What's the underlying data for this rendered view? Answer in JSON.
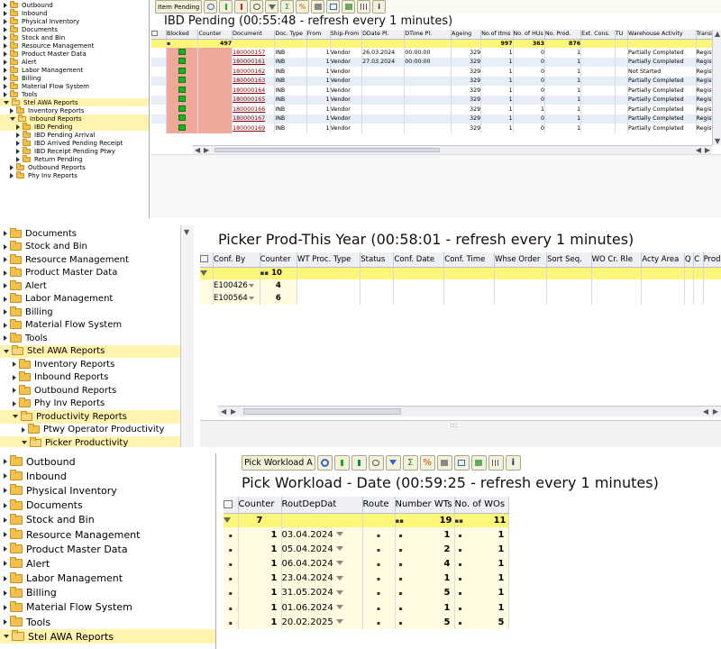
{
  "panel1": {
    "tree": [
      {
        "label": "Outbound",
        "open": false,
        "indent": 0
      },
      {
        "label": "Inbound",
        "open": false,
        "indent": 0
      },
      {
        "label": "Physical Inventory",
        "open": false,
        "indent": 0
      },
      {
        "label": "Documents",
        "open": false,
        "indent": 0
      },
      {
        "label": "Stock and Bin",
        "open": false,
        "indent": 0
      },
      {
        "label": "Resource Management",
        "open": false,
        "indent": 0
      },
      {
        "label": "Product Master Data",
        "open": false,
        "indent": 0
      },
      {
        "label": "Alert",
        "open": false,
        "indent": 0
      },
      {
        "label": "Labor Management",
        "open": false,
        "indent": 0
      },
      {
        "label": "Billing",
        "open": false,
        "indent": 0
      },
      {
        "label": "Material Flow System",
        "open": false,
        "indent": 0
      },
      {
        "label": "Tools",
        "open": false,
        "indent": 0
      },
      {
        "label": "Stel AWA Reports",
        "open": true,
        "indent": 0,
        "highlight": true
      },
      {
        "label": "Inventory Reports",
        "open": false,
        "indent": 1
      },
      {
        "label": "Inbound Reports",
        "open": true,
        "indent": 1,
        "highlight": true
      },
      {
        "label": "IBD Pending",
        "open": false,
        "indent": 2,
        "highlight": true,
        "leaf": true
      },
      {
        "label": "IBD Pending Arrival",
        "open": false,
        "indent": 2,
        "leaf": true
      },
      {
        "label": "IBD Arrived Pending Receipt",
        "open": false,
        "indent": 2,
        "leaf": true
      },
      {
        "label": "IBD Receipt Pending Ptwy",
        "open": false,
        "indent": 2,
        "leaf": true
      },
      {
        "label": "Return Pending",
        "open": false,
        "indent": 2,
        "leaf": true
      },
      {
        "label": "Outbound Reports",
        "open": false,
        "indent": 1
      },
      {
        "label": "Phy Inv Reports",
        "open": false,
        "indent": 1
      }
    ],
    "toolbar_button": "Item Pending",
    "title": "IBD Pending (00:55:48 - refresh every 1 minutes)",
    "columns": [
      "Blocked",
      "Counter",
      "Document",
      "Doc. Type",
      "From",
      "Ship-From",
      "DDate Pl.",
      "DTime Pl.",
      "Ageing",
      "No.of Itms",
      "No. of HUs",
      "No. Prod.",
      "Ext. Cons.",
      "TU",
      "Warehouse Activity",
      "Transit St"
    ],
    "sum": {
      "counter": "497",
      "itms": "997",
      "hus": "363",
      "prod": "876"
    },
    "rows": [
      {
        "doc": "180000157",
        "type": "INB",
        "from": "1",
        "ship": "Vendor",
        "ddate": "26.03.2024",
        "dtime": "00:00:00",
        "age": "329",
        "itms": "1",
        "hus": "0",
        "prod": "1",
        "activity": "Partially Completed",
        "transit": "Registerec"
      },
      {
        "doc": "180000161",
        "type": "INB",
        "from": "1",
        "ship": "Vendor",
        "ddate": "27.03.2024",
        "dtime": "00:00:00",
        "age": "329",
        "itms": "1",
        "hus": "0",
        "prod": "1",
        "activity": "Partially Completed",
        "transit": "Registerec"
      },
      {
        "doc": "180000162",
        "type": "INB",
        "from": "1",
        "ship": "Vendor",
        "ddate": "",
        "dtime": "",
        "age": "329",
        "itms": "1",
        "hus": "0",
        "prod": "1",
        "activity": "Not Started",
        "transit": "Registerec"
      },
      {
        "doc": "180000163",
        "type": "INB",
        "from": "1",
        "ship": "Vendor",
        "ddate": "",
        "dtime": "",
        "age": "329",
        "itms": "1",
        "hus": "0",
        "prod": "1",
        "activity": "Partially Completed",
        "transit": "Registerec"
      },
      {
        "doc": "180000164",
        "type": "INB",
        "from": "1",
        "ship": "Vendor",
        "ddate": "",
        "dtime": "",
        "age": "329",
        "itms": "1",
        "hus": "0",
        "prod": "1",
        "activity": "Partially Completed",
        "transit": "Registerec"
      },
      {
        "doc": "180000165",
        "type": "INB",
        "from": "1",
        "ship": "Vendor",
        "ddate": "",
        "dtime": "",
        "age": "329",
        "itms": "1",
        "hus": "0",
        "prod": "1",
        "activity": "Partially Completed",
        "transit": "Registerec"
      },
      {
        "doc": "180000166",
        "type": "INB",
        "from": "1",
        "ship": "Vendor",
        "ddate": "",
        "dtime": "",
        "age": "329",
        "itms": "1",
        "hus": "1",
        "prod": "1",
        "activity": "Partially Completed",
        "transit": "Registerec"
      },
      {
        "doc": "180000167",
        "type": "INB",
        "from": "1",
        "ship": "Vendor",
        "ddate": "",
        "dtime": "",
        "age": "329",
        "itms": "1",
        "hus": "0",
        "prod": "1",
        "activity": "Partially Completed",
        "transit": "Registerec"
      },
      {
        "doc": "180000169",
        "type": "INB",
        "from": "1",
        "ship": "Vendor",
        "ddate": "",
        "dtime": "",
        "age": "329",
        "itms": "1",
        "hus": "0",
        "prod": "1",
        "activity": "Partially Completed",
        "transit": "Registerec"
      }
    ]
  },
  "panel2": {
    "tree": [
      {
        "label": "Documents",
        "open": false,
        "indent": 0
      },
      {
        "label": "Stock and Bin",
        "open": false,
        "indent": 0
      },
      {
        "label": "Resource Management",
        "open": false,
        "indent": 0
      },
      {
        "label": "Product Master Data",
        "open": false,
        "indent": 0
      },
      {
        "label": "Alert",
        "open": false,
        "indent": 0
      },
      {
        "label": "Labor Management",
        "open": false,
        "indent": 0
      },
      {
        "label": "Billing",
        "open": false,
        "indent": 0
      },
      {
        "label": "Material Flow System",
        "open": false,
        "indent": 0
      },
      {
        "label": "Tools",
        "open": false,
        "indent": 0
      },
      {
        "label": "Stel AWA Reports",
        "open": true,
        "indent": 0,
        "highlight": true
      },
      {
        "label": "Inventory Reports",
        "open": false,
        "indent": 1
      },
      {
        "label": "Inbound Reports",
        "open": false,
        "indent": 1
      },
      {
        "label": "Outbound Reports",
        "open": false,
        "indent": 1
      },
      {
        "label": "Phy Inv Reports",
        "open": false,
        "indent": 1
      },
      {
        "label": "Productivity Reports",
        "open": true,
        "indent": 1,
        "highlight": true
      },
      {
        "label": "Ptwy Operator Productivity",
        "open": false,
        "indent": 2
      },
      {
        "label": "Picker Productivity",
        "open": true,
        "indent": 2,
        "highlight": true
      }
    ],
    "title": "Picker Prod-This Year (00:58:01 - refresh every 1 minutes)",
    "columns": [
      "Conf. By",
      "Counter",
      "WT Proc. Type",
      "Status",
      "Conf. Date",
      "Conf. Time",
      "Whse Order",
      "Sort Seq.",
      "WO Cr. Rle",
      "Acty Area",
      "Q",
      "C",
      "Produ"
    ],
    "sum": {
      "counter": "10"
    },
    "rows": [
      {
        "conf_by": "E100426",
        "counter": "4"
      },
      {
        "conf_by": "E100564",
        "counter": "6"
      }
    ]
  },
  "panel3": {
    "tree": [
      {
        "label": "Outbound",
        "open": false,
        "indent": 0
      },
      {
        "label": "Inbound",
        "open": false,
        "indent": 0
      },
      {
        "label": "Physical Inventory",
        "open": false,
        "indent": 0
      },
      {
        "label": "Documents",
        "open": false,
        "indent": 0
      },
      {
        "label": "Stock and Bin",
        "open": false,
        "indent": 0
      },
      {
        "label": "Resource Management",
        "open": false,
        "indent": 0
      },
      {
        "label": "Product Master Data",
        "open": false,
        "indent": 0
      },
      {
        "label": "Alert",
        "open": false,
        "indent": 0
      },
      {
        "label": "Labor Management",
        "open": false,
        "indent": 0
      },
      {
        "label": "Billing",
        "open": false,
        "indent": 0
      },
      {
        "label": "Material Flow System",
        "open": false,
        "indent": 0
      },
      {
        "label": "Tools",
        "open": false,
        "indent": 0
      },
      {
        "label": "Stel AWA Reports",
        "open": true,
        "indent": 0,
        "highlight": true
      }
    ],
    "toolbar_button": "Pick Workload A",
    "title": "Pick Workload - Date (00:59:25 - refresh every 1 minutes)",
    "columns": [
      "Counter",
      "RoutDepDat",
      "Route",
      "Number WTs",
      "No. of WOs"
    ],
    "sum": {
      "counter": "7",
      "wts": "19",
      "wos": "11"
    },
    "rows": [
      {
        "counter": "1",
        "date": "03.04.2024",
        "wts": "1",
        "wos": "1"
      },
      {
        "counter": "1",
        "date": "05.04.2024",
        "wts": "2",
        "wos": "1"
      },
      {
        "counter": "1",
        "date": "06.04.2024",
        "wts": "4",
        "wos": "1"
      },
      {
        "counter": "1",
        "date": "23.04.2024",
        "wts": "1",
        "wos": "1"
      },
      {
        "counter": "1",
        "date": "31.05.2024",
        "wts": "5",
        "wos": "1"
      },
      {
        "counter": "1",
        "date": "01.06.2024",
        "wts": "1",
        "wos": "1"
      },
      {
        "counter": "1",
        "date": "20.02.2025",
        "wts": "5",
        "wos": "5"
      }
    ]
  },
  "colors": {
    "sum_row": "#fcf77a",
    "tree_highlight": "#fff3b0",
    "status_green": "#22b022",
    "blocked": "#f0a89a",
    "doc_link": "#800000"
  }
}
